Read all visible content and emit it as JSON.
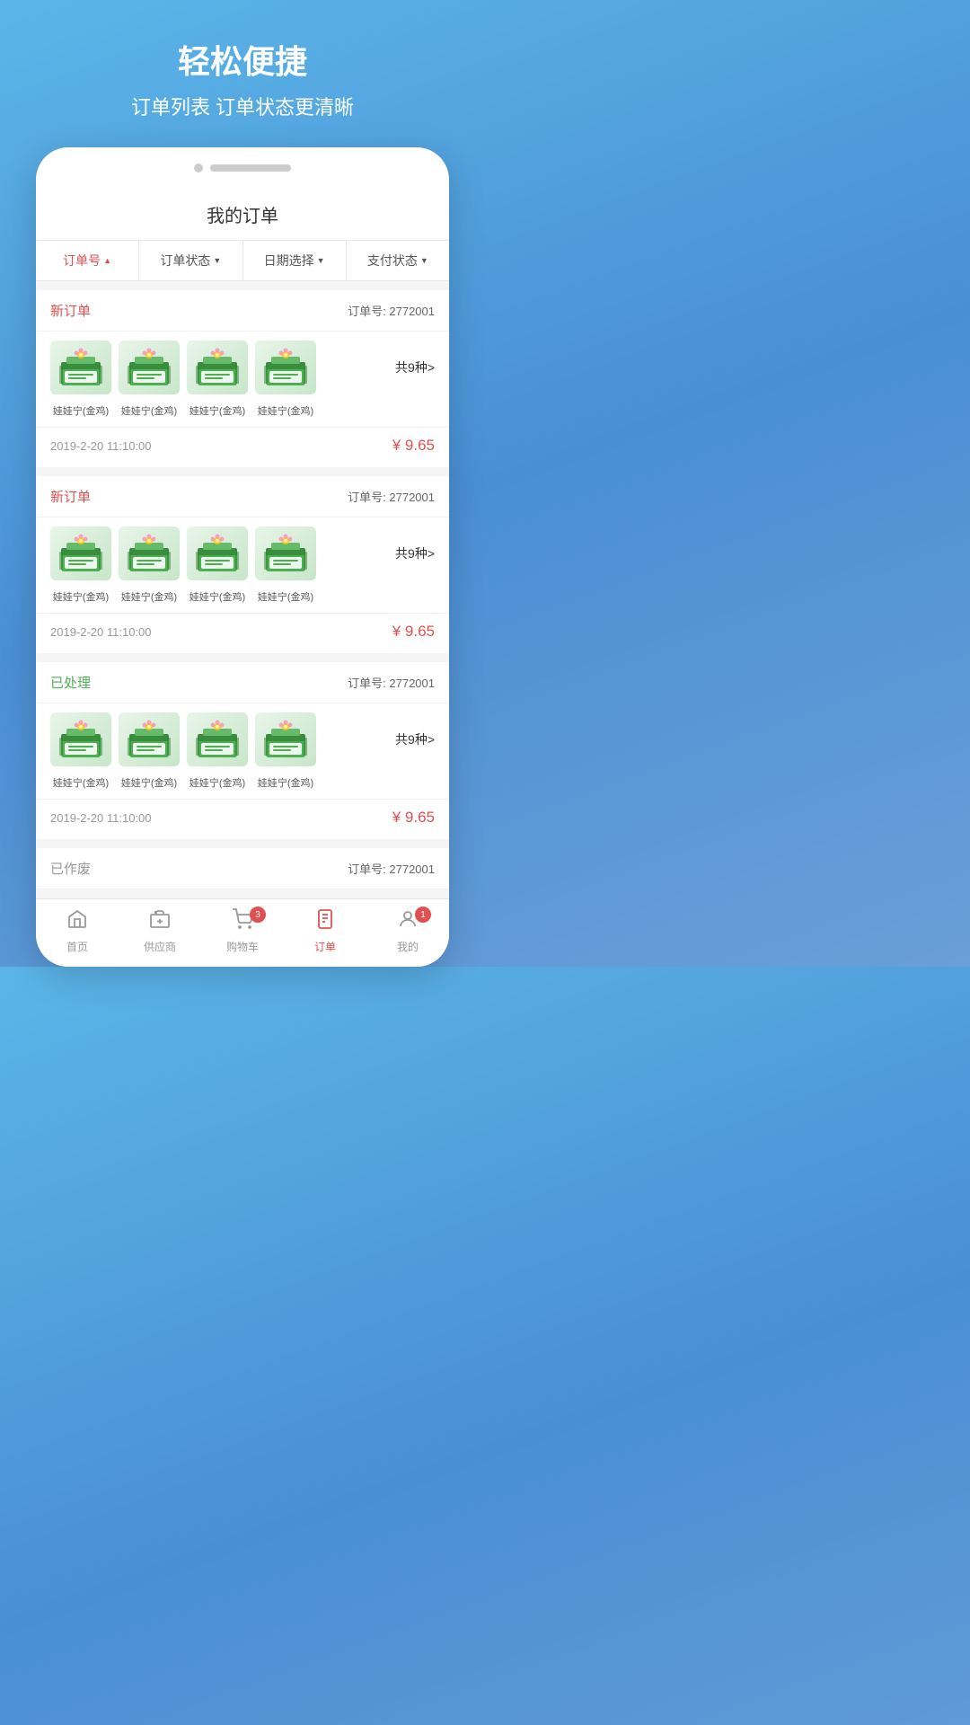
{
  "header": {
    "title": "轻松便捷",
    "subtitle": "订单列表  订单状态更清晰"
  },
  "page": {
    "title": "我的订单"
  },
  "filters": [
    {
      "label": "订单号",
      "arrow": "up",
      "active": true
    },
    {
      "label": "订单状态",
      "arrow": "down",
      "active": false
    },
    {
      "label": "日期选择",
      "arrow": "down",
      "active": false
    },
    {
      "label": "支付状态",
      "arrow": "down",
      "active": false
    }
  ],
  "orders": [
    {
      "status": "新订单",
      "status_type": "new",
      "order_no_label": "订单号: 2772001",
      "products": [
        "娃娃宁(金鸡)",
        "娃娃宁(金鸡)",
        "娃娃宁(金鸡)",
        "娃娃宁(金鸡)"
      ],
      "count_label": "共9种>",
      "date": "2019-2-20  11:10:00",
      "price": "¥ 9.65"
    },
    {
      "status": "新订单",
      "status_type": "new",
      "order_no_label": "订单号: 2772001",
      "products": [
        "娃娃宁(金鸡)",
        "娃娃宁(金鸡)",
        "娃娃宁(金鸡)",
        "娃娃宁(金鸡)"
      ],
      "count_label": "共9种>",
      "date": "2019-2-20  11:10:00",
      "price": "¥ 9.65"
    },
    {
      "status": "已处理",
      "status_type": "processed",
      "order_no_label": "订单号: 2772001",
      "products": [
        "娃娃宁(金鸡)",
        "娃娃宁(金鸡)",
        "娃娃宁(金鸡)",
        "娃娃宁(金鸡)"
      ],
      "count_label": "共9种>",
      "date": "2019-2-20  11:10:00",
      "price": "¥ 9.65"
    },
    {
      "status": "已作废",
      "status_type": "cancelled",
      "order_no_label": "订单号: 2772001",
      "products": [],
      "count_label": "",
      "date": "",
      "price": ""
    }
  ],
  "nav": {
    "items": [
      {
        "label": "首页",
        "icon": "home",
        "active": false,
        "badge": null
      },
      {
        "label": "供应商",
        "icon": "store",
        "active": false,
        "badge": null
      },
      {
        "label": "购物车",
        "icon": "cart",
        "active": false,
        "badge": "3"
      },
      {
        "label": "订单",
        "icon": "order",
        "active": true,
        "badge": null
      },
      {
        "label": "我的",
        "icon": "user",
        "active": false,
        "badge": "1"
      }
    ]
  }
}
